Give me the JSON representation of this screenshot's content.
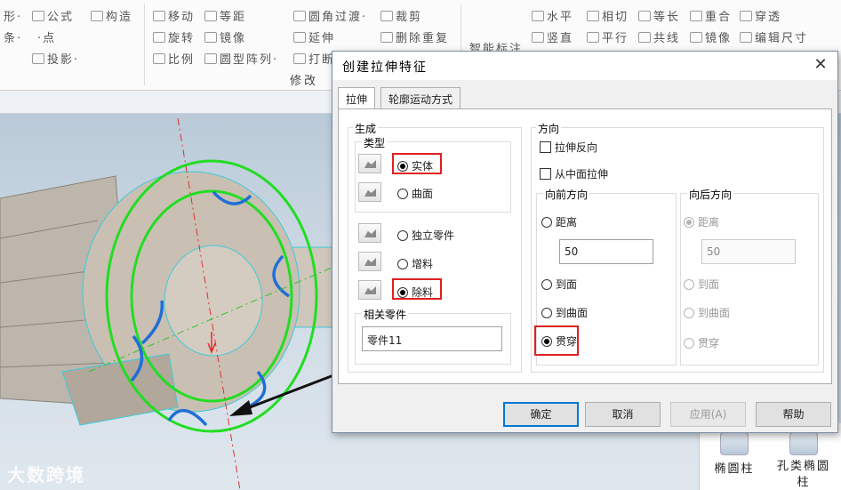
{
  "ribbon": {
    "groups": [
      {
        "label": "修改"
      }
    ],
    "items": [
      {
        "label": "形·"
      },
      {
        "label": "公式"
      },
      {
        "label": "构造"
      },
      {
        "label": "条·"
      },
      {
        "label": "·点"
      },
      {
        "label": "投影·"
      },
      {
        "label": "移动"
      },
      {
        "label": "等距"
      },
      {
        "label": "旋转"
      },
      {
        "label": "镜像"
      },
      {
        "label": "比例"
      },
      {
        "label": "圆型阵列·"
      },
      {
        "label": "圆角过渡·"
      },
      {
        "label": "裁剪"
      },
      {
        "label": "延伸"
      },
      {
        "label": "删除重复"
      },
      {
        "label": "打断"
      },
      {
        "label": "智能标注"
      },
      {
        "label": "水平"
      },
      {
        "label": "相切"
      },
      {
        "label": "等长"
      },
      {
        "label": "重合"
      },
      {
        "label": "穿透"
      },
      {
        "label": "竖直"
      },
      {
        "label": "平行"
      },
      {
        "label": "共线"
      },
      {
        "label": "镜像"
      },
      {
        "label": "编辑尺寸"
      }
    ]
  },
  "dialog": {
    "title": "创建拉伸特征",
    "close_glyph": "✕",
    "tabs": [
      {
        "label": "拉伸",
        "active": true
      },
      {
        "label": "轮廓运动方式",
        "active": false
      }
    ],
    "generate": {
      "legend": "生成",
      "type_legend": "类型",
      "type_options": [
        {
          "label": "实体",
          "selected": true
        },
        {
          "label": "曲面",
          "selected": false
        }
      ],
      "mode_options": [
        {
          "label": "独立零件",
          "selected": false
        },
        {
          "label": "增料",
          "selected": false
        },
        {
          "label": "除料",
          "selected": true
        }
      ],
      "related_part_legend": "相关零件",
      "related_part_value": "零件11"
    },
    "direction": {
      "legend": "方向",
      "reverse_label": "拉伸反向",
      "reverse_checked": false,
      "mid_label": "从中面拉伸",
      "mid_checked": false,
      "forward": {
        "legend": "向前方向",
        "distance_label": "距离",
        "distance_value": "50",
        "to_face_label": "到面",
        "to_surface_label": "到曲面",
        "through_label": "贯穿",
        "selected": "贯穿"
      },
      "backward": {
        "legend": "向后方向",
        "distance_label": "距离",
        "distance_value": "50",
        "to_face_label": "到面",
        "to_surface_label": "到曲面",
        "through_label": "贯穿",
        "selected": "距离"
      }
    },
    "buttons": {
      "ok": "确定",
      "cancel": "取消",
      "apply": "应用(A)",
      "help": "帮助"
    }
  },
  "right_panel": {
    "tools": [
      {
        "label": "椭圆柱"
      },
      {
        "label": "孔类椭圆柱"
      }
    ]
  },
  "watermark": "大数跨境",
  "colors": {
    "highlight": "#e02020",
    "primary_border": "#0078d7",
    "circle_green": "#22dd22",
    "slot_blue": "#1f6fd6"
  }
}
